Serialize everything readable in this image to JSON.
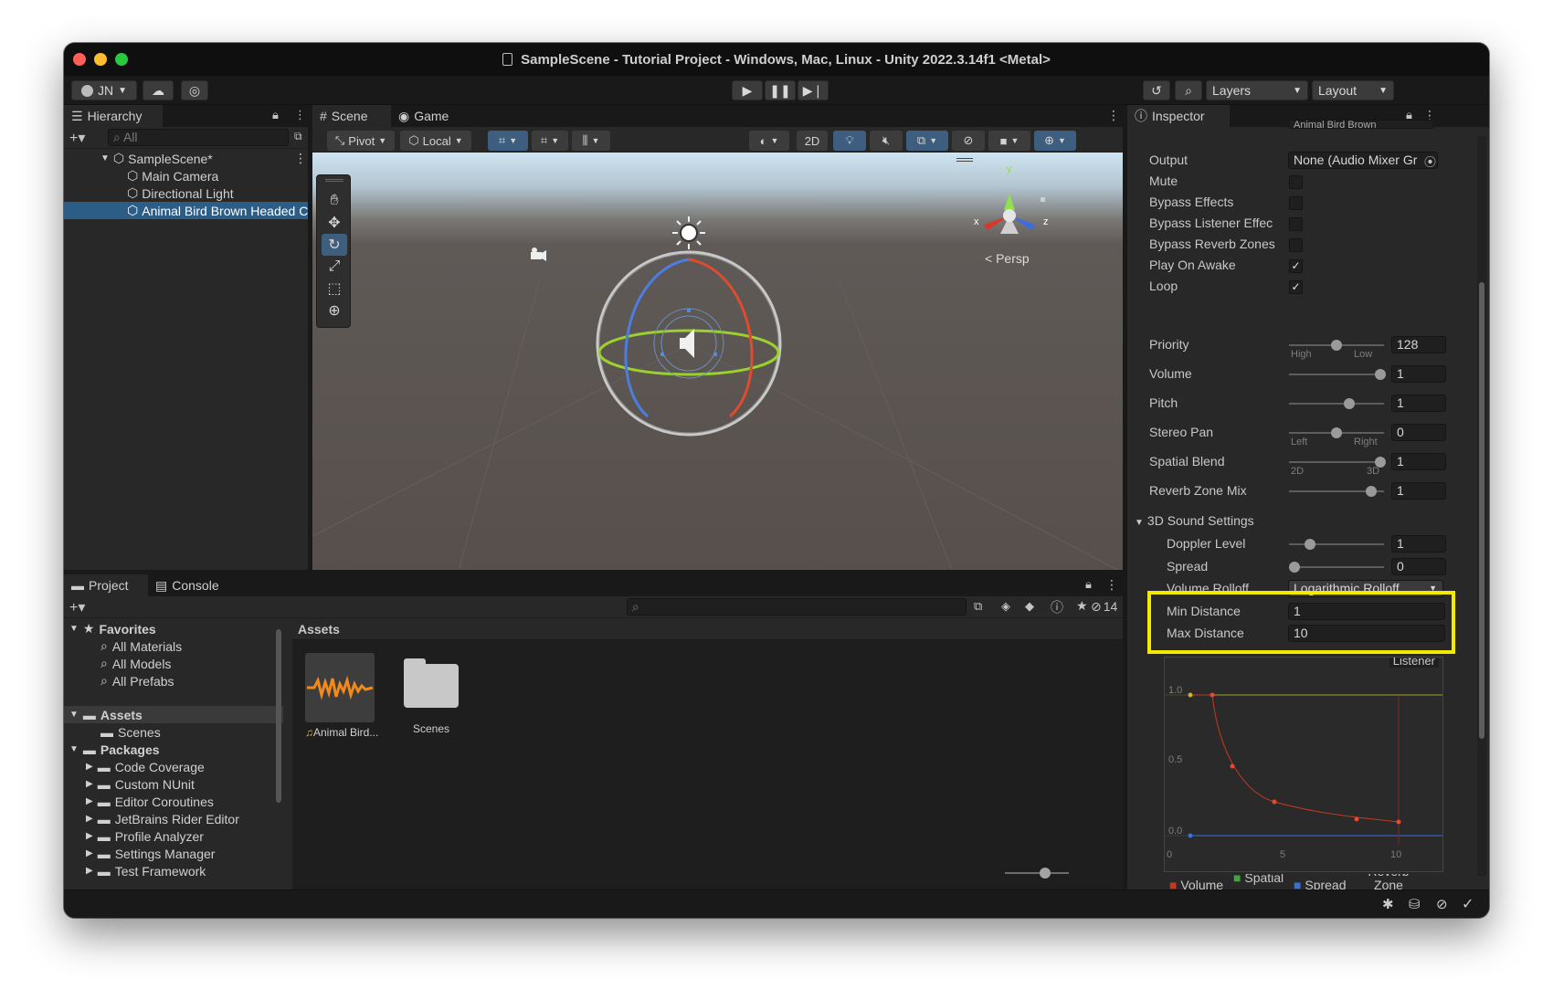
{
  "window": {
    "title": "SampleScene - Tutorial Project - Windows, Mac, Linux - Unity 2022.3.14f1 <Metal>"
  },
  "toolbar": {
    "account": "JN",
    "layers": "Layers",
    "layout": "Layout"
  },
  "hierarchy": {
    "tab": "Hierarchy",
    "search_placeholder": "All",
    "scene": "SampleScene*",
    "items": [
      "Main Camera",
      "Directional Light",
      "Animal Bird Brown Headed C"
    ]
  },
  "scene_view": {
    "tabs": [
      "Scene",
      "Game"
    ],
    "pivot": "Pivot",
    "local": "Local",
    "mode_2d": "2D",
    "persp": "< Persp",
    "gizmo_x": "x",
    "gizmo_y": "y",
    "gizmo_z": "z"
  },
  "project": {
    "tabs": [
      "Project",
      "Console"
    ],
    "hidden_count": "14",
    "favorites": "Favorites",
    "favorite_items": [
      "All Materials",
      "All Models",
      "All Prefabs"
    ],
    "assets": "Assets",
    "asset_children": [
      "Scenes"
    ],
    "packages": "Packages",
    "package_items": [
      "Code Coverage",
      "Custom NUnit",
      "Editor Coroutines",
      "JetBrains Rider Editor",
      "Profile Analyzer",
      "Settings Manager",
      "Test Framework"
    ],
    "breadcrumb": "Assets",
    "grid_items": [
      "Animal Bird...",
      "Scenes"
    ]
  },
  "inspector": {
    "tab": "Inspector",
    "clipped_top": "Animal Bird Brown",
    "output_label": "Output",
    "output_value": "None (Audio Mixer Gr",
    "toggles": [
      {
        "label": "Mute",
        "checked": false
      },
      {
        "label": "Bypass Effects",
        "checked": false
      },
      {
        "label": "Bypass Listener Effec",
        "checked": false
      },
      {
        "label": "Bypass Reverb Zones",
        "checked": false
      },
      {
        "label": "Play On Awake",
        "checked": true
      },
      {
        "label": "Loop",
        "checked": true
      }
    ],
    "sliders": [
      {
        "label": "Priority",
        "value": "128",
        "fraction": 0.5,
        "min_label": "High",
        "max_label": "Low"
      },
      {
        "label": "Volume",
        "value": "1",
        "fraction": 1.0,
        "min_label": "",
        "max_label": ""
      },
      {
        "label": "Pitch",
        "value": "1",
        "fraction": 0.65,
        "min_label": "",
        "max_label": ""
      },
      {
        "label": "Stereo Pan",
        "value": "0",
        "fraction": 0.5,
        "min_label": "Left",
        "max_label": "Right"
      },
      {
        "label": "Spatial Blend",
        "value": "1",
        "fraction": 1.0,
        "min_label": "2D",
        "max_label": "3D"
      },
      {
        "label": "Reverb Zone Mix",
        "value": "1",
        "fraction": 0.9,
        "min_label": "",
        "max_label": ""
      }
    ],
    "sound3d": {
      "header": "3D Sound Settings",
      "doppler_label": "Doppler Level",
      "doppler_value": "1",
      "doppler_fraction": 0.2,
      "spread_label": "Spread",
      "spread_value": "0",
      "spread_fraction": 0.0,
      "rolloff_label": "Volume Rolloff",
      "rolloff_value": "Logarithmic Rolloff",
      "min_label": "Min Distance",
      "min_value": "1",
      "max_label": "Max Distance",
      "max_value": "10",
      "highlight_color": "#f2ea00"
    },
    "graph": {
      "listener": "Listener",
      "y_ticks": [
        "1.0",
        "0.5",
        "0.0"
      ],
      "x_ticks": [
        "0",
        "5",
        "10"
      ],
      "legend": [
        {
          "label": "Volume",
          "color": "#c4391f"
        },
        {
          "label": "Spatial",
          "color": "#3fa63c"
        },
        {
          "label": "Spread",
          "color": "#3b6fd8"
        },
        {
          "label": "Reverb Zone",
          "color": "#c9b629"
        }
      ]
    }
  }
}
